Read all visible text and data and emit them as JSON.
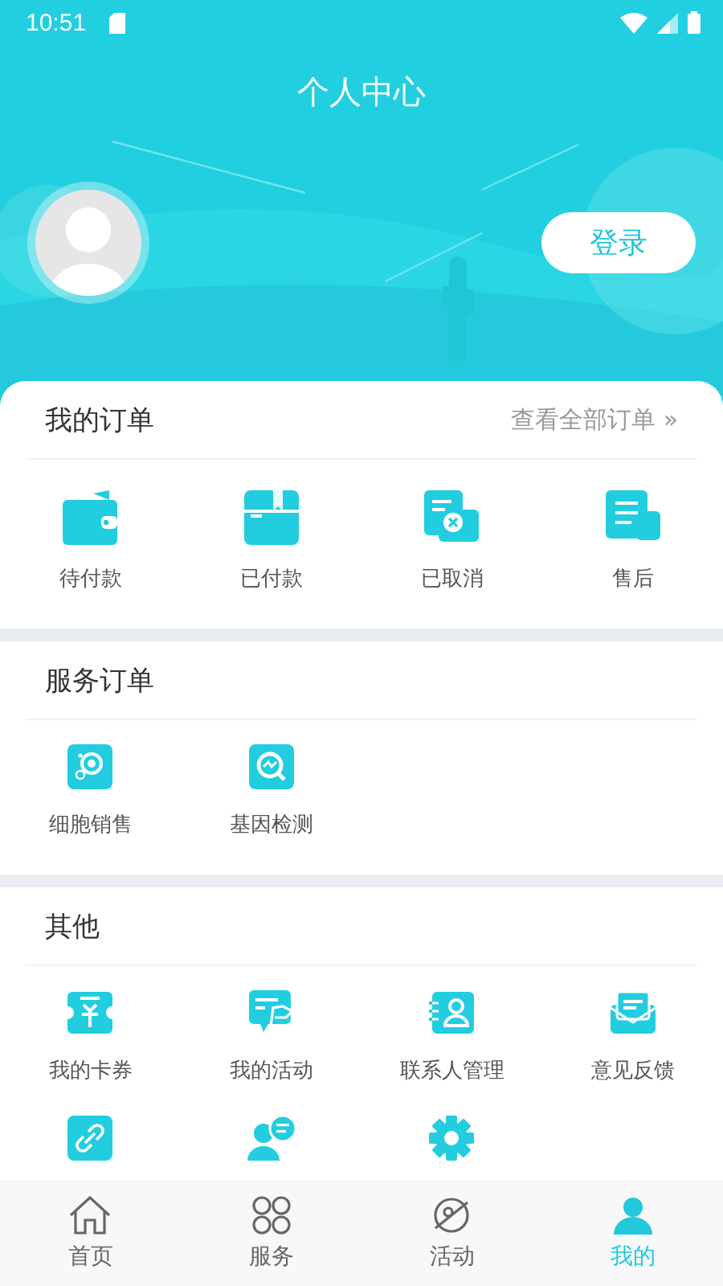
{
  "status_bar": {
    "time": "10:51"
  },
  "header": {
    "title": "个人中心",
    "login_button": "登录"
  },
  "my_orders": {
    "title": "我的订单",
    "link": "查看全部订单 »",
    "items": [
      {
        "label": "待付款"
      },
      {
        "label": "已付款"
      },
      {
        "label": "已取消"
      },
      {
        "label": "售后"
      }
    ]
  },
  "service_orders": {
    "title": "服务订单",
    "items": [
      {
        "label": "细胞销售"
      },
      {
        "label": "基因检测"
      }
    ]
  },
  "others": {
    "title": "其他",
    "items": [
      {
        "kind": "tile",
        "label": "我的卡券"
      },
      {
        "kind": "tile",
        "label": "我的活动"
      },
      {
        "kind": "tile",
        "label": "联系人管理"
      },
      {
        "kind": "tile",
        "label": "意见反馈"
      },
      {
        "kind": "cut_tile"
      },
      {
        "kind": "cut_tile"
      },
      {
        "kind": "cut_tile"
      }
    ]
  },
  "tab_bar": [
    {
      "label": "首页",
      "selected": false
    },
    {
      "label": "服务",
      "selected": false
    },
    {
      "label": "活动",
      "selected": false
    },
    {
      "label": "我的",
      "selected": true
    }
  ]
}
